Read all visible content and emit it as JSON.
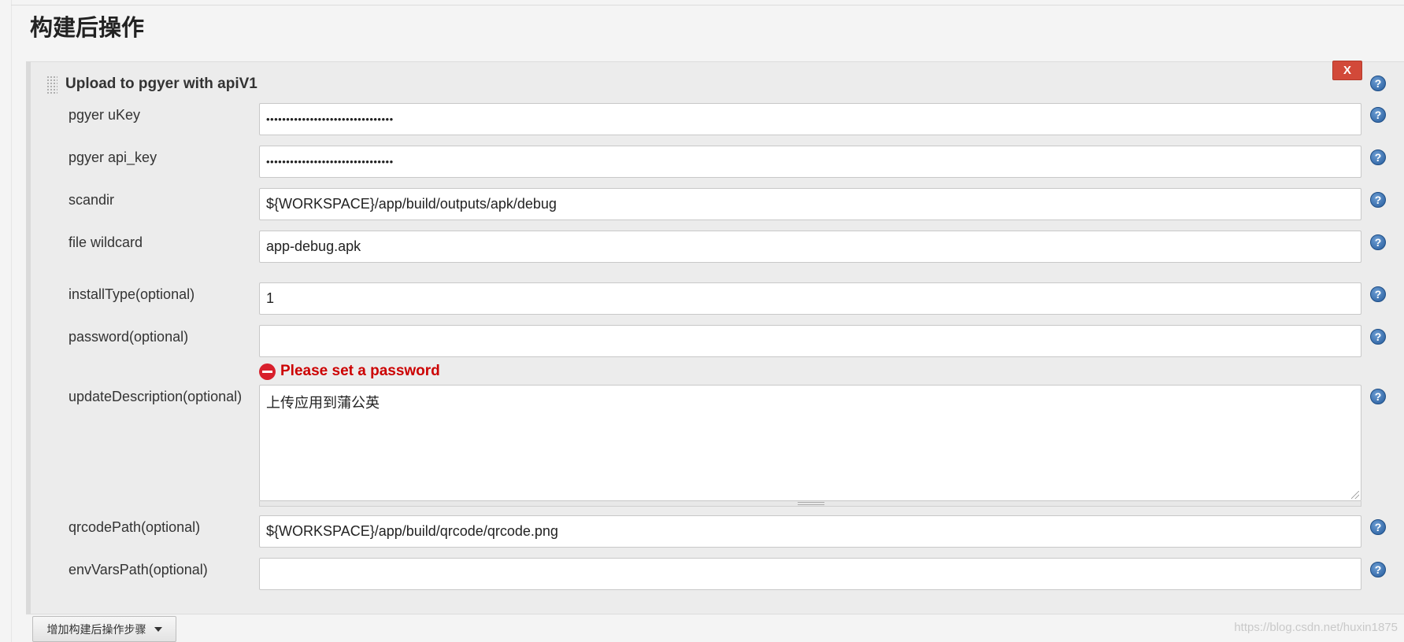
{
  "section": {
    "title": "构建后操作"
  },
  "step": {
    "title": "Upload to pgyer with apiV1",
    "delete_label": "X"
  },
  "help_glyph": "?",
  "fields": [
    {
      "label": "pgyer uKey",
      "value": "••••••••••••••••••••••••••••••••",
      "type": "password"
    },
    {
      "label": "pgyer api_key",
      "value": "••••••••••••••••••••••••••••••••",
      "type": "password"
    },
    {
      "label": "scandir",
      "value": "${WORKSPACE}/app/build/outputs/apk/debug",
      "type": "text"
    },
    {
      "label": "file wildcard",
      "value": "app-debug.apk",
      "type": "text"
    },
    {
      "label": "installType(optional)",
      "value": "1",
      "type": "text"
    },
    {
      "label": "password(optional)",
      "value": "",
      "type": "text"
    },
    {
      "label": "updateDescription(optional)",
      "value": "上传应用到蒲公英",
      "type": "textarea"
    },
    {
      "label": "qrcodePath(optional)",
      "value": "${WORKSPACE}/app/build/qrcode/qrcode.png",
      "type": "text"
    },
    {
      "label": "envVarsPath(optional)",
      "value": "",
      "type": "text"
    }
  ],
  "password_error": "Please set a password",
  "add_step_button": "增加构建后操作步骤",
  "watermark": "https://blog.csdn.net/huxin1875",
  "colors": {
    "error": "#cc0000",
    "delete_button": "#d24939",
    "help_icon": "#255b9c"
  },
  "icons": {
    "help": "help-icon",
    "error": "error-icon",
    "drag": "drag-handle-icon",
    "caret": "caret-down-icon"
  }
}
